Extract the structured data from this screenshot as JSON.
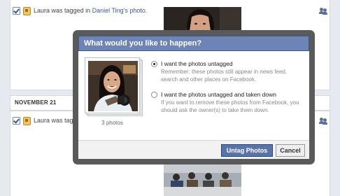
{
  "feed": {
    "item1": {
      "name": "Laura",
      "middle": "was tagged in",
      "link": "Daniel Ting's photo."
    },
    "date_separator": "NOVEMBER 21",
    "item2": {
      "name": "Laura",
      "middle": "was tagg"
    }
  },
  "dialog": {
    "title": "What would you like to happen?",
    "photo_count_label": "3 photos",
    "options": [
      {
        "label": "I want the photos untagged",
        "description": "Remember: these photos still appear in news feed, search and other places on Facebook.",
        "selected": true
      },
      {
        "label": "I want the photos untagged and taken down",
        "description": "If you want to remove these photos from Facebook, you should ask the owner(s) to take them down.",
        "selected": false
      }
    ],
    "buttons": {
      "primary": "Untag Photos",
      "cancel": "Cancel"
    }
  },
  "icons": {
    "checkbox": "checkmark-box-icon",
    "privacy": "lock-icon",
    "audience": "friends-icon"
  },
  "colors": {
    "title_bar": "#6d84b4",
    "link": "#3b5998",
    "primary_button": "#5b74a8",
    "frame": "#5a5a5a"
  }
}
